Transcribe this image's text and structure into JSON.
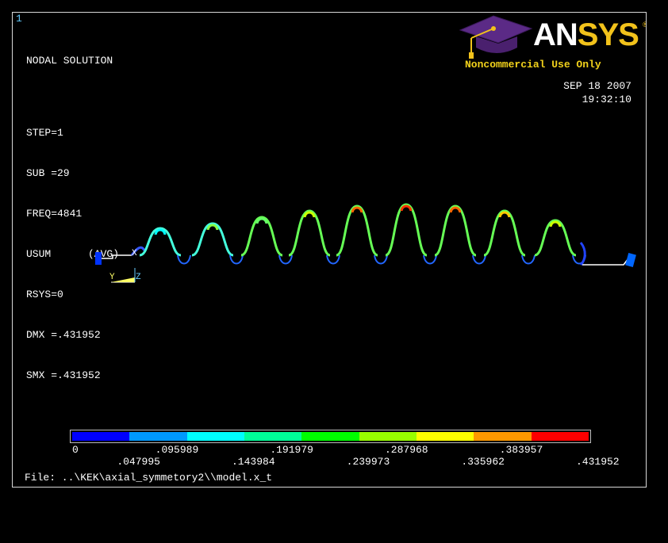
{
  "window_number": "1",
  "info": {
    "title": "NODAL SOLUTION",
    "step": "STEP=1",
    "sub": "SUB =29",
    "freq": "FREQ=4841",
    "usum": "USUM      (AVG)",
    "rsys": "RSYS=0",
    "dmx": "DMX =.431952",
    "smx": "SMX =.431952"
  },
  "logo": {
    "an": "AN",
    "sys": "SYS",
    "reg": "®",
    "noncommercial": "Noncommercial Use Only",
    "mortarboard_icon": "graduation-cap-icon"
  },
  "datetime": {
    "date": "SEP 18 2007",
    "time": "19:32:10"
  },
  "axis_triad": {
    "x": "X",
    "y": "Y",
    "z": "Z"
  },
  "legend": {
    "colors": [
      "#0000ff",
      "#0099ff",
      "#00ffff",
      "#00ff99",
      "#00ff00",
      "#99ff00",
      "#ffff00",
      "#ff9900",
      "#ff0000"
    ],
    "top_labels": [
      "0",
      ".095989",
      ".191979",
      ".287968",
      ".383957"
    ],
    "bottom_labels": [
      ".047995",
      ".143984",
      ".239973",
      ".335962",
      ".431952"
    ]
  },
  "file_line": "File: ..\\KEK\\axial_symmetory2\\\\model.x_t"
}
